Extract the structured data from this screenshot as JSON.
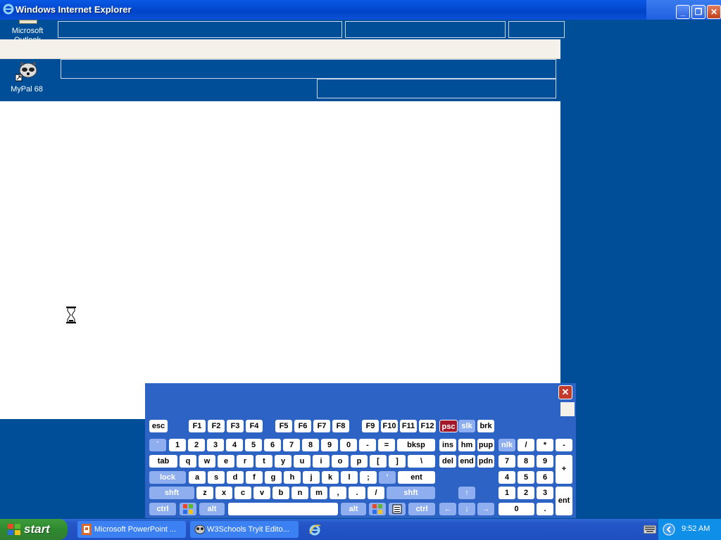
{
  "window": {
    "title": "Windows Internet Explorer"
  },
  "desktop_icons": [
    {
      "label": "Microsoft Outlook",
      "icon": "outlook-icon"
    },
    {
      "label": "MyPal 68",
      "icon": "raccoon-icon"
    }
  ],
  "keyboard": {
    "row_fn": [
      "esc",
      "F1",
      "F2",
      "F3",
      "F4",
      "F5",
      "F6",
      "F7",
      "F8",
      "F9",
      "F10",
      "F11",
      "F12",
      "psc",
      "slk",
      "brk"
    ],
    "row_num": [
      "`",
      "1",
      "2",
      "3",
      "4",
      "5",
      "6",
      "7",
      "8",
      "9",
      "0",
      "-",
      "=",
      "bksp",
      "ins",
      "hm",
      "pup",
      "nlk",
      "/",
      "*",
      "-"
    ],
    "row_tab": [
      "tab",
      "q",
      "w",
      "e",
      "r",
      "t",
      "y",
      "u",
      "i",
      "o",
      "p",
      "[",
      "]",
      "\\",
      "del",
      "end",
      "pdn",
      "7",
      "8",
      "9",
      "+"
    ],
    "row_lock": [
      "lock",
      "a",
      "s",
      "d",
      "f",
      "g",
      "h",
      "j",
      "k",
      "l",
      ";",
      "'",
      "ent",
      "4",
      "5",
      "6"
    ],
    "row_shift": [
      "shft",
      "z",
      "x",
      "c",
      "v",
      "b",
      "n",
      "m",
      ",",
      ".",
      "/",
      "shft",
      "↑",
      "1",
      "2",
      "3",
      "ent"
    ],
    "row_ctrl": [
      "ctrl",
      "alt",
      "alt",
      "ctrl",
      "←",
      "↓",
      "→",
      "0",
      "."
    ]
  },
  "taskbar": {
    "start_label": "start",
    "tasks": [
      {
        "label": "Microsoft PowerPoint ...",
        "icon": "powerpoint-icon"
      },
      {
        "label": "W3Schools Tryit Edito...",
        "icon": "mypal-icon"
      }
    ],
    "quicklaunch_icon": "ie-icon",
    "clock": "9:52 AM"
  },
  "colors": {
    "desktop": "#004e98",
    "titlebar": "#0a58e6",
    "taskbar": "#2456c8",
    "start": "#3c9a3c",
    "osk": "#2c63c4"
  }
}
